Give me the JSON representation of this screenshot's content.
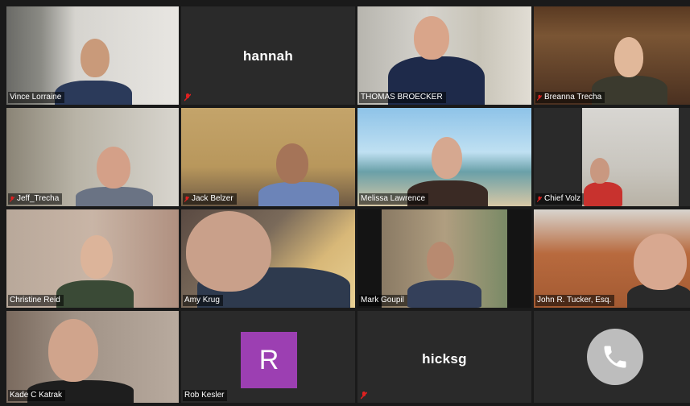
{
  "participants": [
    {
      "name": "Vince Lorraine",
      "muted": false
    },
    {
      "name": "hannah",
      "muted": true
    },
    {
      "name": "THOMAS BROECKER",
      "muted": false
    },
    {
      "name": "Breanna Trecha",
      "muted": true
    },
    {
      "name": "Jeff_Trecha",
      "muted": true
    },
    {
      "name": "Jack Belzer",
      "muted": true
    },
    {
      "name": "Melissa Lawrence",
      "muted": false
    },
    {
      "name": "Chief Volz",
      "muted": true
    },
    {
      "name": "Christine Reid",
      "muted": false
    },
    {
      "name": "Amy Krug",
      "muted": false
    },
    {
      "name": "Mark Goupil",
      "muted": false
    },
    {
      "name": "John R. Tucker, Esq.",
      "muted": false
    },
    {
      "name": "Kade C Katrak",
      "muted": false
    },
    {
      "name": "Rob Kesler",
      "muted": false
    },
    {
      "name": "hicksg",
      "muted": true
    },
    {
      "name": "",
      "muted": false
    }
  ],
  "avatar_letter": "R",
  "active_speaker": "Mark Goupil",
  "colors": {
    "active_border": "#d4d04a",
    "avatar_bg": "#9c3fb2",
    "mute_red": "#e02020"
  },
  "icons": {
    "mute": "mic-muted-icon",
    "phone": "phone-icon"
  }
}
